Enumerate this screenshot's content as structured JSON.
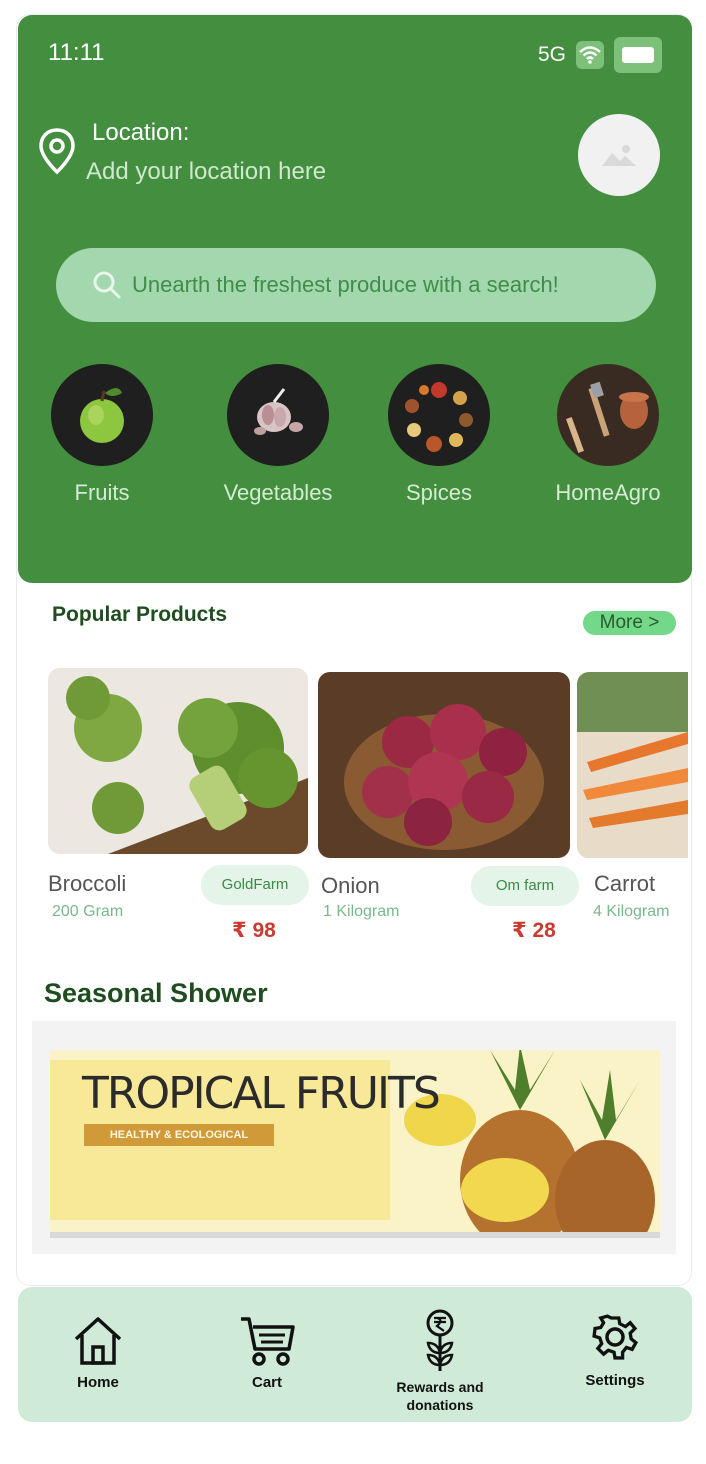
{
  "status": {
    "time": "11:11",
    "network": "5G"
  },
  "location": {
    "label": "Location:",
    "value": "Add your location here"
  },
  "search": {
    "placeholder": "Unearth the freshest produce with a search!"
  },
  "categories": [
    {
      "label": "Fruits",
      "icon": "apple-image"
    },
    {
      "label": "Vegetables",
      "icon": "garlic-image"
    },
    {
      "label": "Spices",
      "icon": "spices-image"
    },
    {
      "label": "HomeAgro",
      "icon": "gardening-tools-image"
    }
  ],
  "popular": {
    "title": "Popular Products",
    "more": "More >",
    "products": [
      {
        "name": "Broccoli",
        "qty": "200 Gram",
        "farm": "GoldFarm",
        "price": "₹ 98"
      },
      {
        "name": "Onion",
        "qty": "1 Kilogram",
        "farm": "Om farm",
        "price": "₹ 28"
      },
      {
        "name": "Carrot",
        "qty": "4 Kilogram"
      }
    ]
  },
  "seasonal": {
    "title": "Seasonal Shower",
    "banner_title": "TROPICAL FRUITS",
    "banner_subtitle": "HEALTHY & ECOLOGICAL"
  },
  "nav": {
    "home": "Home",
    "cart": "Cart",
    "rewards": "Rewards and donations",
    "settings": "Settings"
  },
  "colors": {
    "primary_green": "#438e3f",
    "search_bg": "#a3d8ae",
    "nav_bg": "#cfead6",
    "price_red": "#c93b30"
  }
}
